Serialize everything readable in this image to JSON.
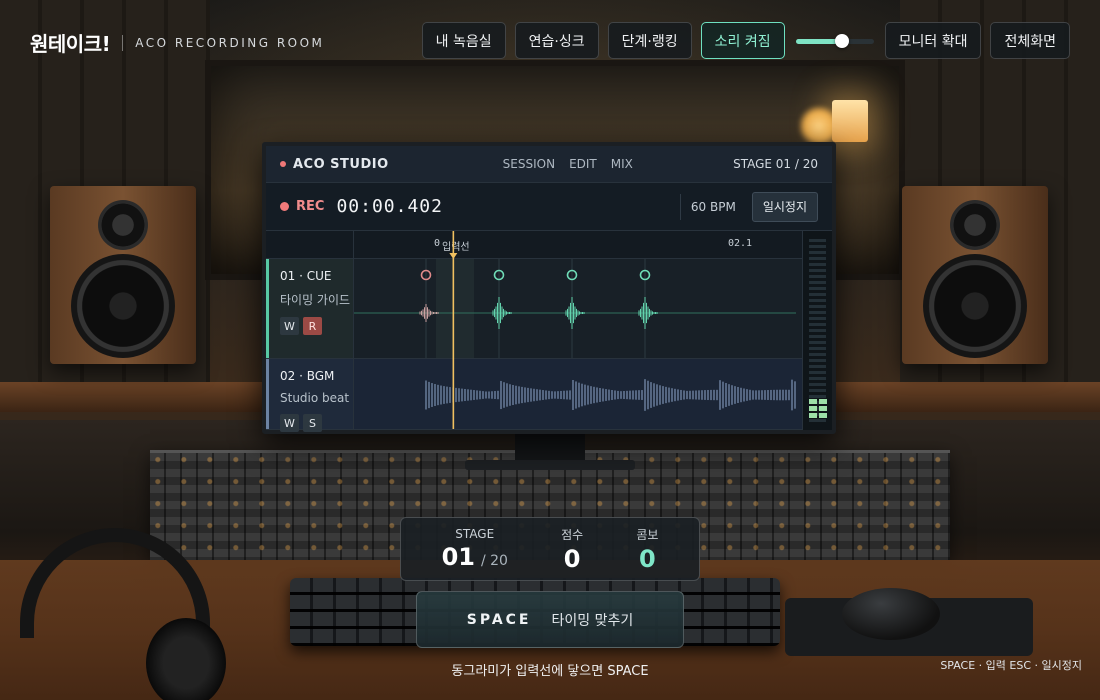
{
  "brand": {
    "name": "원테이크!",
    "subtitle": "ACO RECORDING ROOM"
  },
  "nav": {
    "buttons": [
      {
        "label": "내 녹음실",
        "active": false
      },
      {
        "label": "연습·싱크",
        "active": false
      },
      {
        "label": "단계·랭킹",
        "active": false
      },
      {
        "label": "소리 켜짐",
        "active": true
      }
    ],
    "volume": 0.6,
    "monitor_label": "모니터 확대",
    "fullscreen_label": "전체화면"
  },
  "daw": {
    "studio": "ACO STUDIO",
    "menu": [
      "SESSION",
      "EDIT",
      "MIX"
    ],
    "stage": "STAGE 01 / 20",
    "rec_label": "REC",
    "timecode": "00:00.402",
    "bpm": "60 BPM",
    "pause_label": "일시정지",
    "ruler": {
      "start_label": "0",
      "input_line_label": "입력선",
      "end_label": "02.1"
    },
    "tracks": [
      {
        "name": "01 · CUE",
        "sub": "타이밍 가이드",
        "chips": [
          "W",
          "R"
        ]
      },
      {
        "name": "02 · BGM",
        "sub": "Studio beat",
        "chips": [
          "W",
          "S"
        ]
      }
    ],
    "cue_beats_sec": [
      0.0,
      1.0,
      2.0,
      3.0
    ],
    "playhead_sec": 0.402
  },
  "score": {
    "stage_label": "STAGE",
    "stage_value": "01",
    "stage_total": "/ 20",
    "score_label": "점수",
    "score_value": "0",
    "combo_label": "콤보",
    "combo_value": "0"
  },
  "action": {
    "key": "SPACE",
    "label": "타이밍 맞추기"
  },
  "hint": "동그라미가 입력선에 닿으면 SPACE",
  "shortcuts": "SPACE · 입력   ESC · 일시정지",
  "colors": {
    "accent": "#7fe3c4",
    "rec": "#f17a7a",
    "playhead": "#f0c060"
  }
}
